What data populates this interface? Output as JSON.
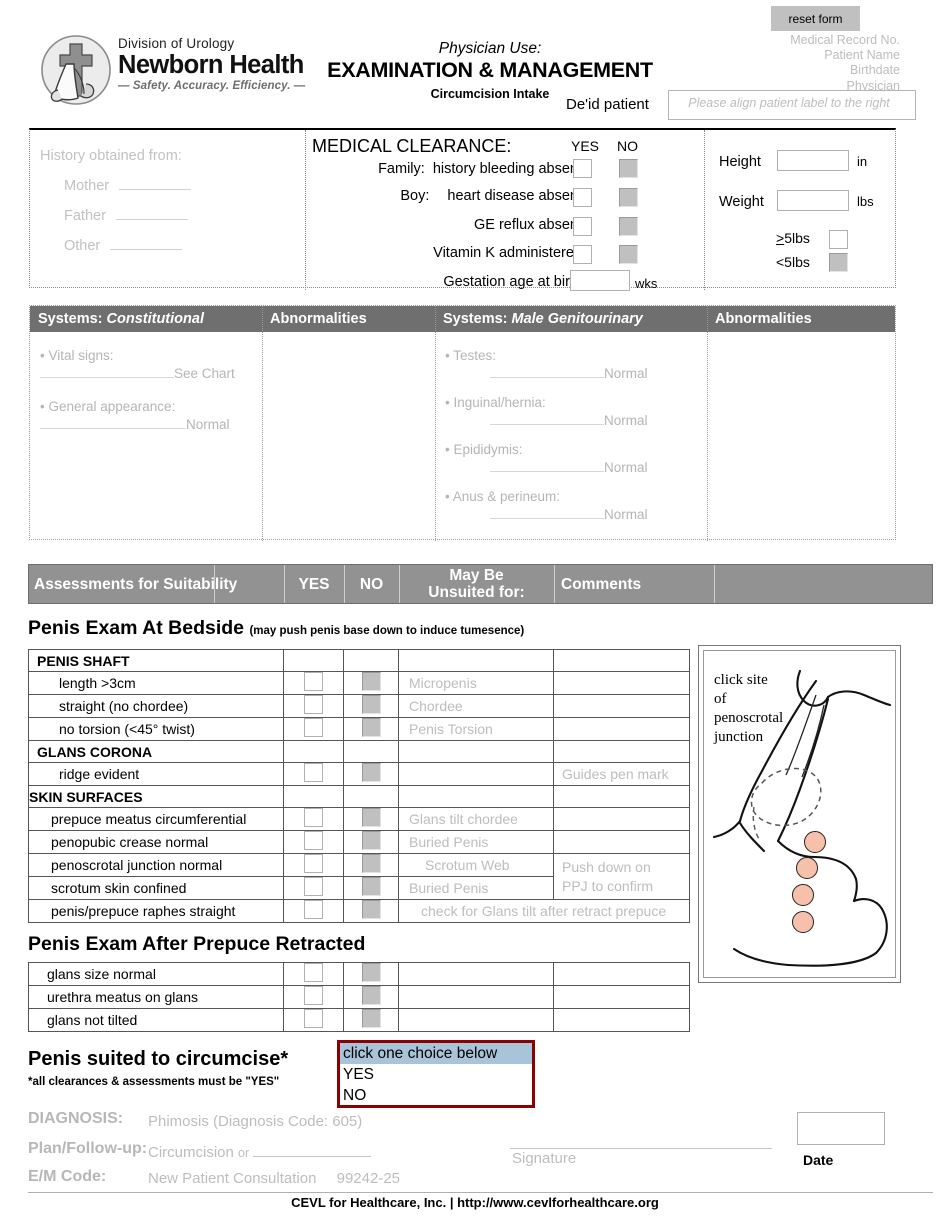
{
  "header": {
    "logo": {
      "division": "Division of Urology",
      "name": "Newborn Health",
      "tagline": "— Safety. Accuracy. Efficiency. —"
    },
    "physician_use": "Physician Use:",
    "title": "EXAMINATION & MANAGEMENT",
    "subtitle": "Circumcision Intake",
    "deid_label": "De'id patient",
    "label_placeholder": "Please align patient label to the right",
    "reset_button": "reset form",
    "patient_fields": [
      "Medical Record No.",
      "Patient Name",
      "Birthdate",
      "Physician"
    ]
  },
  "history": {
    "title": "History obtained from:",
    "options": [
      "Mother",
      "Father",
      "Other"
    ]
  },
  "clearance": {
    "title": "MEDICAL CLEARANCE:",
    "yes_header": "YES",
    "no_header": "NO",
    "rows": [
      {
        "prefix": "Family:",
        "text": "history bleeding absent"
      },
      {
        "prefix": "Boy:",
        "text": "heart disease absent"
      },
      {
        "prefix": "",
        "text": "GE reflux absent"
      },
      {
        "prefix": "",
        "text": "Vitamin K administered"
      }
    ],
    "gestation_label": "Gestation age at birth",
    "gestation_value": "",
    "gestation_unit": "wks"
  },
  "vitals": {
    "height_label": "Height",
    "height_value": "",
    "height_unit": "in",
    "weight_label": "Weight",
    "weight_value": "",
    "weight_unit": "lbs",
    "ge5_label": ">5lbs",
    "lt5_label": "<5lbs"
  },
  "systems": {
    "col1_header": "Systems: Constitutional",
    "col2_header": "Abnormalities",
    "col3_header": "Systems: Male Genitourinary",
    "col4_header": "Abnormalities",
    "constitutional": [
      {
        "label": "• Vital signs:",
        "value": "See Chart"
      },
      {
        "label": "• General appearance:",
        "value": "Normal"
      }
    ],
    "genitourinary": [
      {
        "label": "• Testes:",
        "value": "Normal"
      },
      {
        "label": "• Inguinal/hernia:",
        "value": "Normal"
      },
      {
        "label": "• Epididymis:",
        "value": "Normal"
      },
      {
        "label": "• Anus & perineum:",
        "value": "Normal"
      }
    ]
  },
  "assessments": {
    "bar": {
      "title": "Assessments for Suitability",
      "yes": "YES",
      "no": "NO",
      "unsuited": "May Be\nUnsuited for:",
      "unsuited_line1": "May Be",
      "unsuited_line2": "Unsuited for:",
      "comments": "Comments"
    },
    "bedside_title": "Penis Exam At Bedside",
    "bedside_note": "(may push penis base down to induce tumesence)",
    "rows": [
      {
        "type": "section",
        "label": "PENIS SHAFT",
        "unsuited": "",
        "comment": ""
      },
      {
        "type": "item",
        "label": "length  >3cm",
        "unsuited": "Micropenis",
        "comment": ""
      },
      {
        "type": "item",
        "label": "straight (no chordee)",
        "unsuited": "Chordee",
        "comment": ""
      },
      {
        "type": "item",
        "label": "no torsion  (<45° twist)",
        "unsuited": "Penis Torsion",
        "comment": ""
      },
      {
        "type": "section",
        "label": "GLANS CORONA",
        "unsuited": "",
        "comment": ""
      },
      {
        "type": "item",
        "label": "ridge evident",
        "unsuited": "",
        "comment": "Guides pen mark"
      },
      {
        "type": "section",
        "label": "SKIN SURFACES",
        "unsuited": "",
        "comment": ""
      },
      {
        "type": "item",
        "label": "prepuce meatus circumferential",
        "unsuited": "Glans tilt chordee",
        "comment": ""
      },
      {
        "type": "item",
        "label": "penopubic crease normal",
        "unsuited": "Buried Penis",
        "comment": ""
      },
      {
        "type": "item",
        "label": "penoscrotal junction normal",
        "unsuited": "Scrotum Web",
        "comment": "Push down on"
      },
      {
        "type": "item",
        "label": "scrotum skin confined",
        "unsuited": "Buried Penis",
        "comment": "PPJ  to confirm"
      },
      {
        "type": "item",
        "label": "penis/prepuce raphes straight",
        "unsuited": "check for Glans tilt after retract prepuce",
        "comment": ""
      }
    ],
    "ppj_comment_line1": "Push down on",
    "ppj_comment_line2": "PPJ  to confirm",
    "retracted_title": "Penis Exam After Prepuce Retracted",
    "retracted_rows": [
      {
        "label": "glans size normal",
        "unsuited": "",
        "comment": ""
      },
      {
        "label": "urethra meatus on glans",
        "unsuited": "",
        "comment": ""
      },
      {
        "label": "glans not tilted",
        "unsuited": "",
        "comment": ""
      }
    ]
  },
  "diagram": {
    "caption_lines": [
      "click site",
      "of",
      "penoscrotal",
      "junction"
    ],
    "hotspot_color": "#f7c0aa",
    "hotspot_count": 4
  },
  "suited": {
    "title": "Penis suited to circumcise*",
    "note": "*all clearances & assessments must be \"YES\"",
    "select_options": [
      "click one choice below",
      "YES",
      "NO"
    ],
    "selected_index": 0,
    "border_color": "#8b0000"
  },
  "footer_fields": {
    "diagnosis_label": "DIAGNOSIS:",
    "diagnosis_value": "Phimosis  (Diagnosis Code: 605)",
    "plan_label": "Plan/Follow-up:",
    "plan_value": "Circumcision",
    "plan_or": "or",
    "em_label": "E/M Code:",
    "em_value": "New Patient Consultation",
    "em_code": "99242-25",
    "signature_label": "Signature",
    "date_label": "Date",
    "date_value": ""
  },
  "footer": {
    "text": "CEVL for Healthcare, Inc.   |   http://www.cevlforhealthcare.org"
  }
}
